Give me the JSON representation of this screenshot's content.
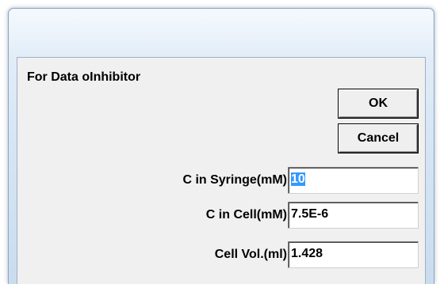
{
  "dialog": {
    "heading": "For Data oInhibitor",
    "ok_label": "OK",
    "cancel_label": "Cancel"
  },
  "fields": {
    "syringe": {
      "label": "C in Syringe(mM)",
      "value": "10",
      "selected": true
    },
    "cell": {
      "label": "C in Cell(mM)",
      "value": "7.5E-6"
    },
    "volume": {
      "label": "Cell Vol.(ml)",
      "value": "1.428"
    }
  },
  "colors": {
    "selection": "#3399ff",
    "client_background": "#f0f0f0",
    "frame": "#d7e6f5"
  }
}
